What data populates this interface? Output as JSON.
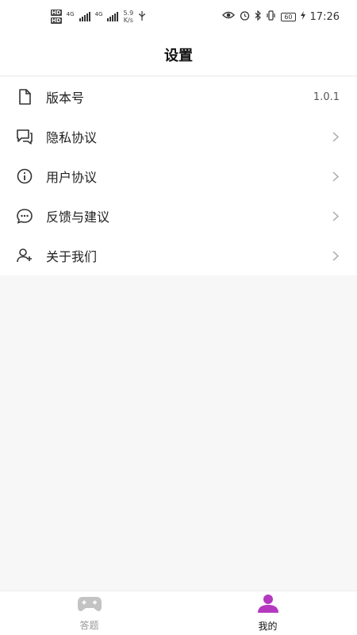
{
  "status_bar": {
    "hd1": "HD",
    "hd2": "HD",
    "net1": "4G",
    "net2": "4G",
    "speed_value": "5.9",
    "speed_unit": "K/s",
    "battery": "60",
    "time": "17:26"
  },
  "header": {
    "title": "设置"
  },
  "menu": {
    "items": [
      {
        "label": "版本号",
        "value": "1.0.1",
        "icon": "document-icon"
      },
      {
        "label": "隐私协议",
        "icon": "chat-icon"
      },
      {
        "label": "用户协议",
        "icon": "info-icon"
      },
      {
        "label": "反馈与建议",
        "icon": "feedback-icon"
      },
      {
        "label": "关于我们",
        "icon": "user-add-icon"
      }
    ]
  },
  "tabs": [
    {
      "label": "答题",
      "icon": "gamepad-icon",
      "active": false
    },
    {
      "label": "我的",
      "icon": "person-icon",
      "active": true
    }
  ],
  "colors": {
    "active_tab": "#b439c0",
    "inactive_tab": "#bbbbbb",
    "page_bg": "#f7f7f7"
  }
}
